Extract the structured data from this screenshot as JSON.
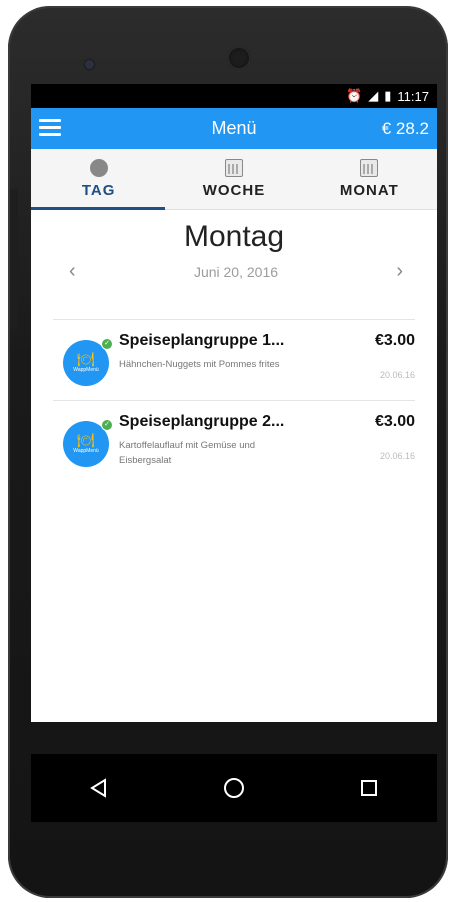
{
  "status_bar": {
    "time": "11:17",
    "alarm_icon": "alarm-icon",
    "signal_icon": "signal-icon",
    "battery_icon": "battery-icon"
  },
  "app_bar": {
    "title": "Menü",
    "balance": "€ 28.2",
    "menu_icon": "hamburger-icon",
    "accent_color": "#2196f3"
  },
  "tabs": [
    {
      "label": "TAG",
      "icon": "gear-icon",
      "active": true
    },
    {
      "label": "WOCHE",
      "icon": "calendar-icon",
      "active": false
    },
    {
      "label": "MONAT",
      "icon": "calendar-icon",
      "active": false
    }
  ],
  "day_header": {
    "weekday": "Montag",
    "date": "Juni 20, 2016",
    "prev_icon": "chevron-left-icon",
    "next_icon": "chevron-right-icon"
  },
  "menu_items": [
    {
      "name": "Speiseplangruppe 1...",
      "description": "Hähnchen-Nuggets mit Pommes frites",
      "price": "€3.00",
      "date": "20.06.16",
      "logo_text": "WappMenü"
    },
    {
      "name": "Speiseplangruppe 2...",
      "description": "Kartoffelauflauf mit Gemüse und Eisbergsalat",
      "price": "€3.00",
      "date": "20.06.16",
      "logo_text": "WappMenü"
    }
  ],
  "nav_bar": {
    "back_icon": "back-triangle-icon",
    "home_icon": "home-circle-icon",
    "recents_icon": "recents-square-icon"
  }
}
